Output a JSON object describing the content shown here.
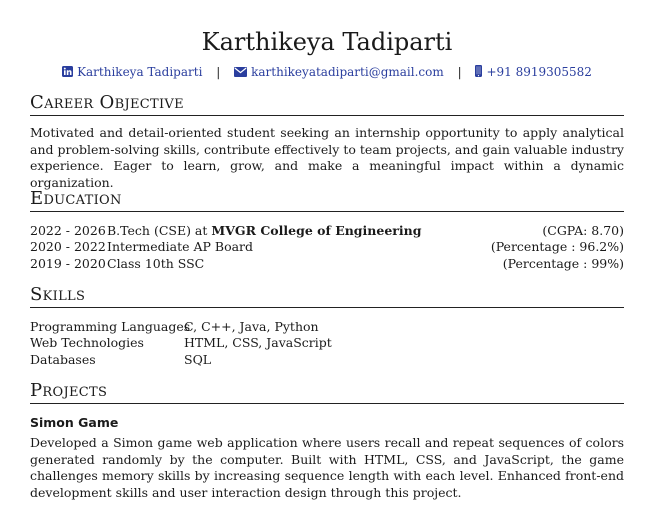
{
  "header": {
    "name": "Karthikeya Tadiparti",
    "linkedin": "Karthikeya Tadiparti",
    "email": "karthikeyatadiparti@gmail.com",
    "phone": "+91 8919305582",
    "separator": "|",
    "linkedin_icon": "linkedin-icon",
    "email_icon": "envelope-icon",
    "phone_icon": "mobile-phone-icon",
    "link_color": "#2a3e9e"
  },
  "objective": {
    "title": "Career Objective",
    "text": "Motivated and detail-oriented student seeking an internship opportunity to apply analytical and problem-solving skills, contribute effectively to team projects, and gain valuable industry experience. Eager to learn, grow, and make a meaningful impact within a dynamic organization."
  },
  "education": {
    "title": "Education",
    "rows": [
      {
        "years": "2022 - 2026",
        "prefix": "B.Tech (CSE) at ",
        "school": "MVGR College of Engineering",
        "score": "(CGPA: 8.70)"
      },
      {
        "years": "2020 - 2022",
        "prefix": "Intermediate AP Board",
        "school": "",
        "score": "(Percentage : 96.2%)"
      },
      {
        "years": "2019 - 2020",
        "prefix": "Class 10th SSC",
        "school": "",
        "score": "(Percentage : 99%)"
      }
    ]
  },
  "skills": {
    "title": "Skills",
    "rows": [
      {
        "category": "Programming Languages",
        "items": "C, C++, Java, Python"
      },
      {
        "category": "Web Technologies",
        "items": "HTML, CSS, JavaScript"
      },
      {
        "category": "Databases",
        "items": "SQL"
      }
    ]
  },
  "projects": {
    "title": "Projects",
    "items": [
      {
        "name": "Simon Game",
        "description": "Developed a Simon game web application where users recall and repeat sequences of colors generated randomly by the computer. Built with HTML, CSS, and JavaScript, the game challenges memory skills by increasing sequence length with each level. Enhanced front-end development skills and user interaction design through this project."
      }
    ]
  }
}
